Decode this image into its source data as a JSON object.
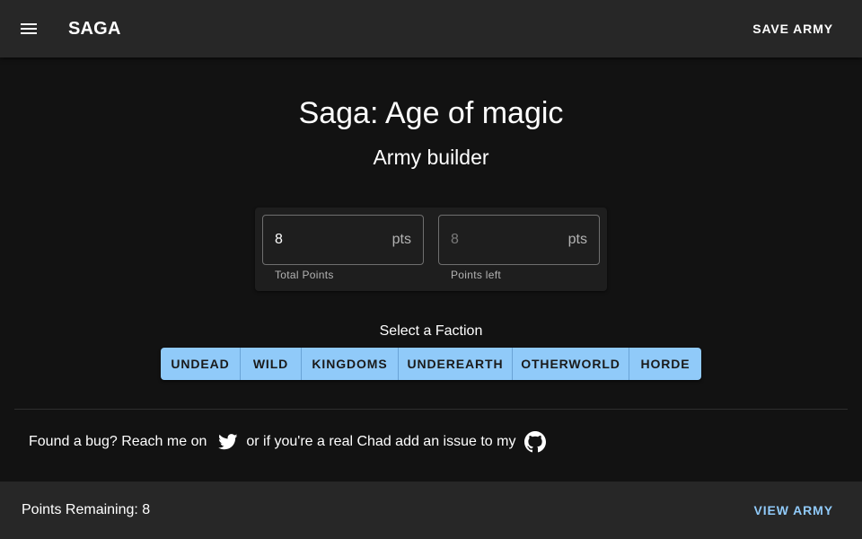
{
  "appbar": {
    "menu_icon": "menu-icon",
    "title": "SAGA",
    "save_label": "SAVE ARMY"
  },
  "main": {
    "title": "Saga: Age of magic",
    "subtitle": "Army builder"
  },
  "points": {
    "total": {
      "value": "8",
      "suffix": "pts",
      "helper": "Total Points"
    },
    "left": {
      "value": "8",
      "suffix": "pts",
      "helper": "Points left"
    }
  },
  "factions": {
    "label": "Select a Faction",
    "items": [
      "UNDEAD",
      "WILD",
      "KINGDOMS",
      "UNDEREARTH",
      "OTHERWORLD",
      "HORDE"
    ]
  },
  "footer": {
    "text_before": "Found a bug? Reach me on",
    "twitter_icon": "twitter-icon",
    "text_middle": "or if you're a real Chad add an issue to my",
    "github_icon": "github-icon"
  },
  "bottombar": {
    "points_remaining": "Points Remaining: 8",
    "view_label": "VIEW ARMY"
  },
  "colors": {
    "background": "#121212",
    "appbar": "#272727",
    "accent": "#90caf9"
  }
}
